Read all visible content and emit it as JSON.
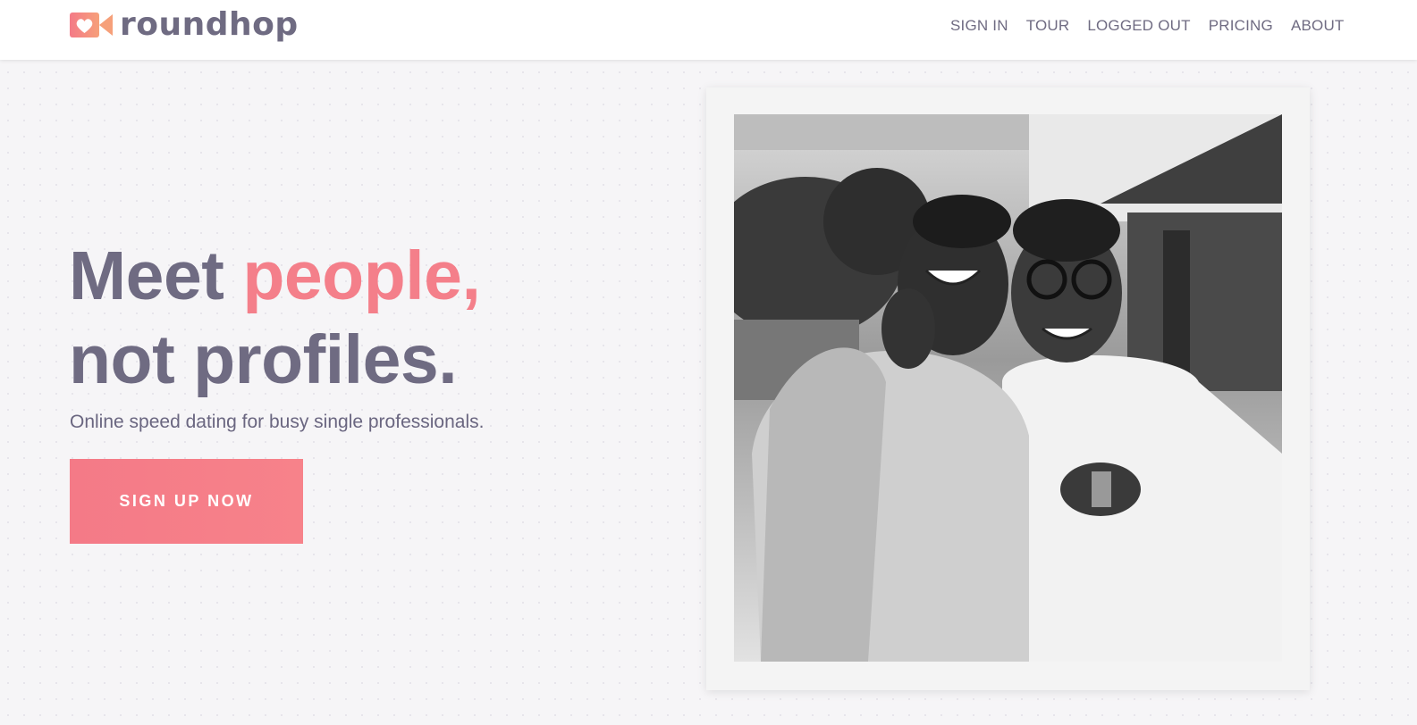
{
  "brand": {
    "name": "roundhop",
    "logo_icon": "heart-camera-icon",
    "colors": {
      "primary_text": "#6f6b82",
      "accent": "#f47f8a"
    }
  },
  "nav": {
    "items": [
      {
        "label": "SIGN IN"
      },
      {
        "label": "TOUR"
      },
      {
        "label": "LOGGED OUT"
      },
      {
        "label": "PRICING"
      },
      {
        "label": "ABOUT"
      }
    ]
  },
  "hero": {
    "title_part1": "Meet ",
    "title_accent": "people,",
    "title_line2": "not profiles.",
    "subtitle": "Online speed dating for busy single professionals.",
    "cta_label": "SIGN UP NOW"
  }
}
